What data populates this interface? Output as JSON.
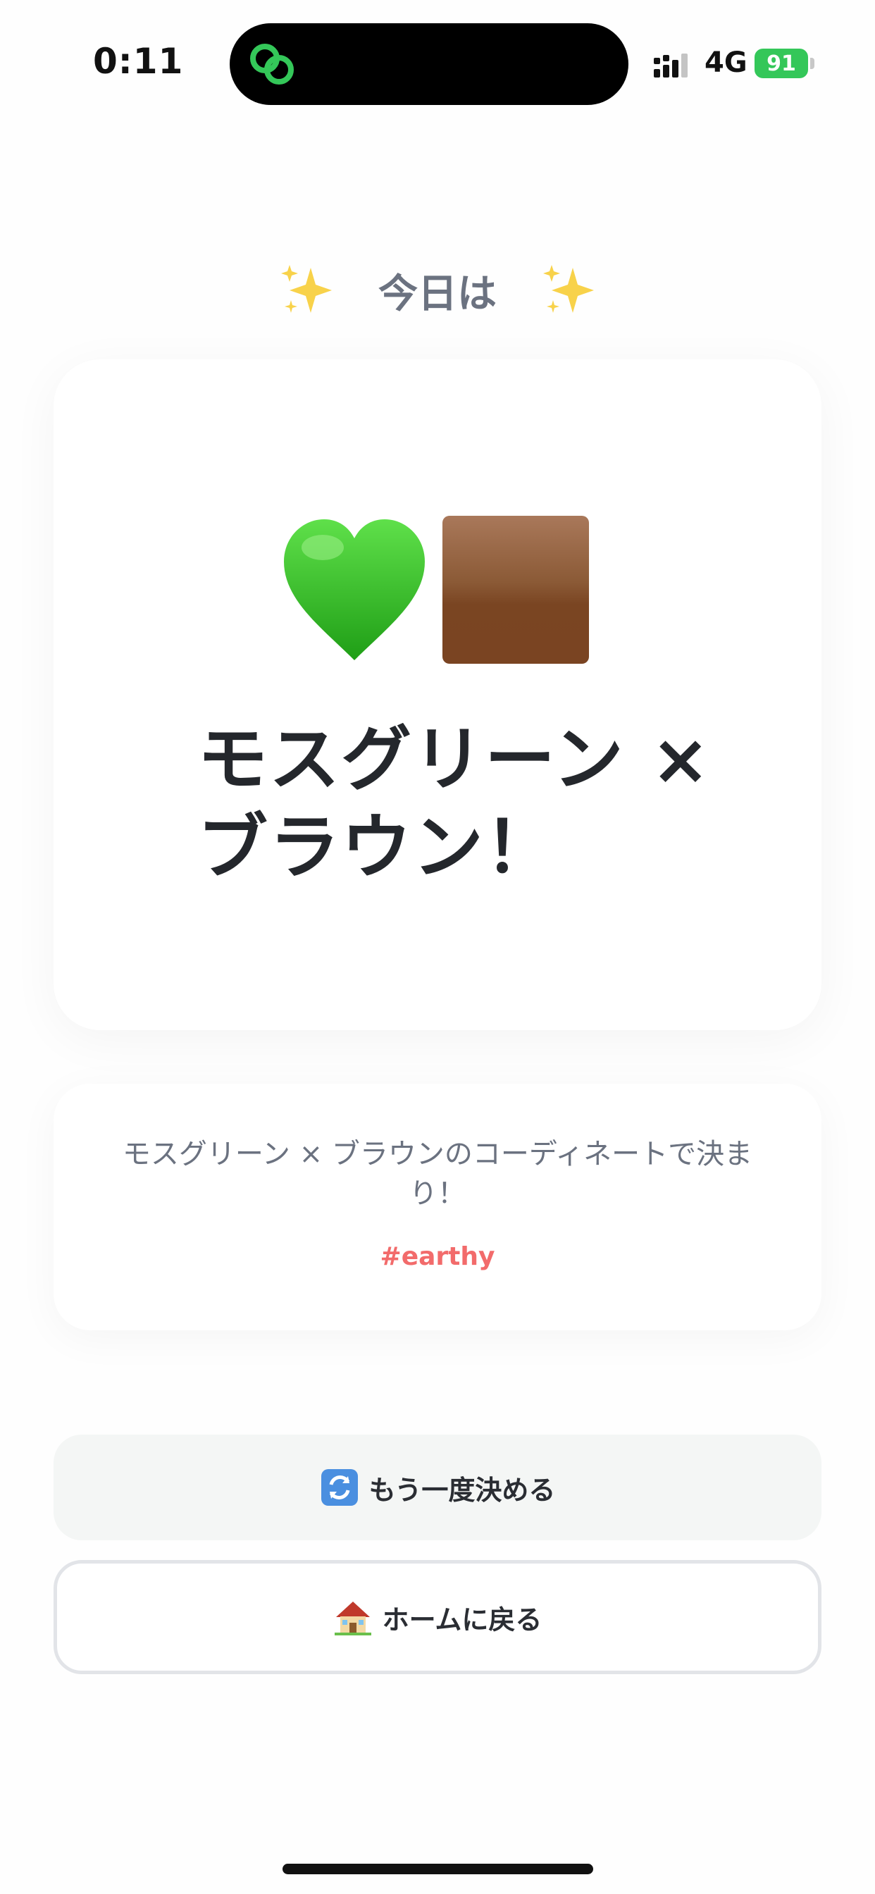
{
  "status_bar": {
    "time": "0:11",
    "network": "4G",
    "battery": "91"
  },
  "header": {
    "today_label": "今日は",
    "sparkle_icon": "sparkles-icon"
  },
  "result": {
    "emojis": [
      "green-heart-icon",
      "brown-square-icon"
    ],
    "title": "モスグリーン × ブラウン！"
  },
  "description": {
    "text": "モスグリーン × ブラウンのコーディネートで決まり！",
    "tag": "#earthy"
  },
  "buttons": {
    "retry_label": "もう一度決める",
    "home_label": "ホームに戻る"
  },
  "colors": {
    "tag": "#f26b6b",
    "battery": "#34c759",
    "retry_bg": "#f4f6f5"
  }
}
